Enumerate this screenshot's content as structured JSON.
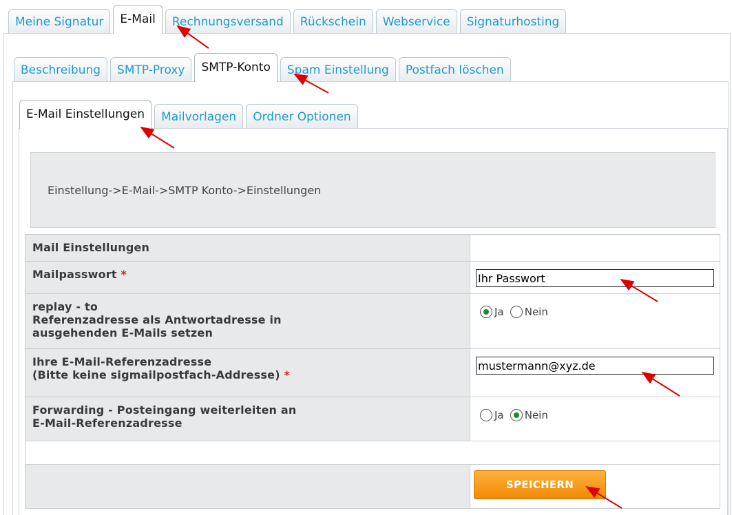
{
  "tabs_level1": [
    "Meine Signatur",
    "E-Mail",
    "Rechnungsversand",
    "Rückschein",
    "Webservice",
    "Signaturhosting"
  ],
  "tabs_level2": [
    "Beschreibung",
    "SMTP-Proxy",
    "SMTP-Konto",
    "Spam Einstellung",
    "Postfach löschen"
  ],
  "tabs_level3": [
    "E-Mail Einstellungen",
    "Mailvorlagen",
    "Ordner Optionen"
  ],
  "breadcrumb": "Einstellung->E-Mail->SMTP Konto->Einstellungen",
  "form": {
    "section_title": "Mail Einstellungen",
    "mailpasswort_label": "Mailpasswort",
    "mailpasswort_value": "Ihr Passwort",
    "required_mark": "*",
    "replay_label_1": "replay - to",
    "replay_label_2": "Referenzadresse als Antwortadresse in",
    "replay_label_3": "ausgehenden E-Mails setzen",
    "referenz_label_1": "Ihre E-Mail-Referenzadresse",
    "referenz_label_2": "(Bitte keine sigmailpostfach-Addresse)",
    "referenz_value": "mustermann@xyz.de",
    "forwarding_label_1": "Forwarding - Posteingang weiterleiten an",
    "forwarding_label_2": "E-Mail-Referenzadresse",
    "radio_yes": "Ja",
    "radio_no": "Nein",
    "replay_selected": "Ja",
    "forwarding_selected": "Nein",
    "save_label": "SPEICHERN"
  },
  "colors": {
    "tab_text": "#1f9bd0",
    "save_button": "#f7960f",
    "arrow": "#e00000",
    "radio_dot": "#1d8a2e"
  }
}
